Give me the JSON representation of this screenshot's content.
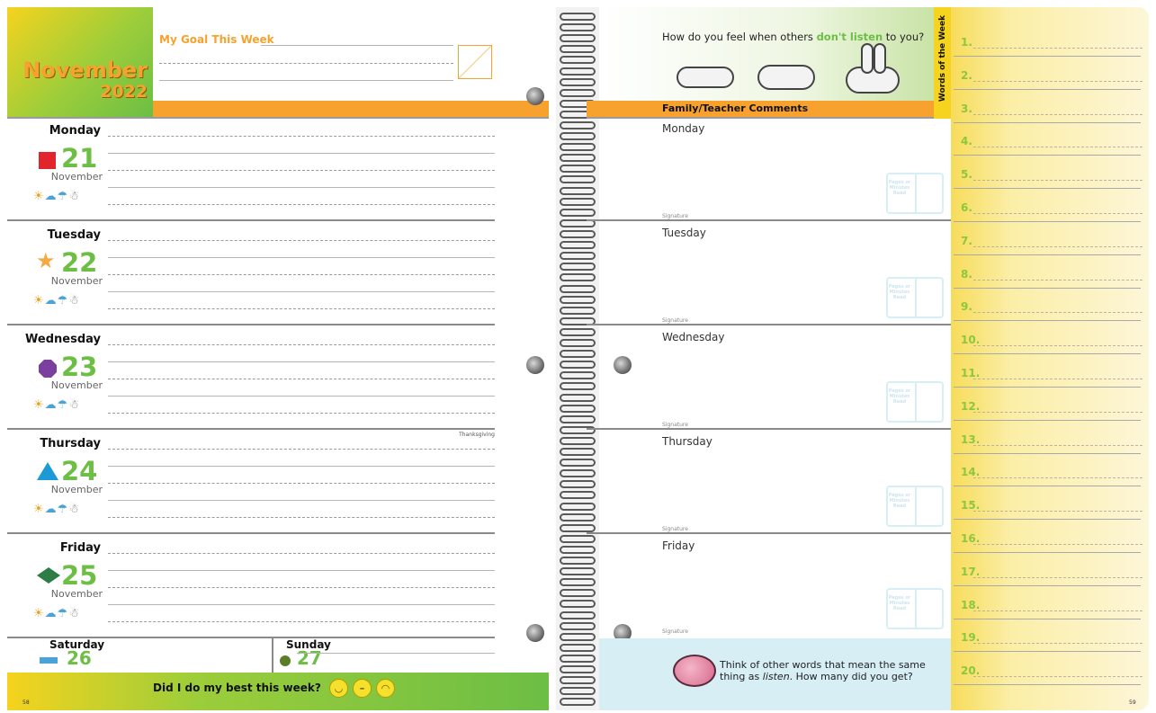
{
  "header": {
    "month": "November",
    "year": "2022",
    "goal_title": "My Goal This Week"
  },
  "days": [
    {
      "name": "Monday",
      "number": "21",
      "month": "November",
      "shape": "square",
      "color": "#e2242c",
      "note": ""
    },
    {
      "name": "Tuesday",
      "number": "22",
      "month": "November",
      "shape": "star",
      "color": "#f7a841",
      "note": ""
    },
    {
      "name": "Wednesday",
      "number": "23",
      "month": "November",
      "shape": "octagon",
      "color": "#7b3fa0",
      "note": ""
    },
    {
      "name": "Thursday",
      "number": "24",
      "month": "November",
      "shape": "triangle",
      "color": "#1b9ad6",
      "note": "Thanksgiving"
    },
    {
      "name": "Friday",
      "number": "25",
      "month": "November",
      "shape": "diamond",
      "color": "#2e7d46",
      "note": ""
    }
  ],
  "weekend": [
    {
      "name": "Saturday",
      "number": "26",
      "shape": "rectangle",
      "color": "#4aa3d8"
    },
    {
      "name": "Sunday",
      "number": "27",
      "shape": "circle",
      "color": "#5b7d26"
    }
  ],
  "weather_icons": [
    "sun-icon",
    "cloud-icon",
    "rain-icon",
    "snowman-icon"
  ],
  "footer": {
    "question": "Did I do my best this week?",
    "faces": [
      "happy-face-icon",
      "neutral-face-icon",
      "sad-face-icon"
    ],
    "page_left": "58",
    "page_right": "59"
  },
  "right": {
    "question_pre": "How do you feel when others ",
    "question_em": "don't listen",
    "question_post": " to you?",
    "comments_title": "Family/Teacher Comments",
    "words_title": "Words of the Week",
    "signature": "Signature",
    "book_text": "Pages or Minutes Read",
    "comment_days": [
      "Monday",
      "Tuesday",
      "Wednesday",
      "Thursday",
      "Friday"
    ],
    "bottom_pre": "Think of other words that mean the same thing as ",
    "bottom_em": "listen",
    "bottom_post": ". How many did you get?"
  },
  "word_numbers": [
    "1.",
    "2.",
    "3.",
    "4.",
    "5.",
    "6.",
    "7.",
    "8.",
    "9.",
    "10.",
    "11.",
    "12.",
    "13.",
    "14.",
    "15.",
    "16.",
    "17.",
    "18.",
    "19.",
    "20."
  ],
  "colors": {
    "green": "#6cbe45",
    "orange": "#f7a12e",
    "yellow": "#f5d31e",
    "lightblue": "#d6eef4",
    "lightgreen": "#dcebc4"
  }
}
